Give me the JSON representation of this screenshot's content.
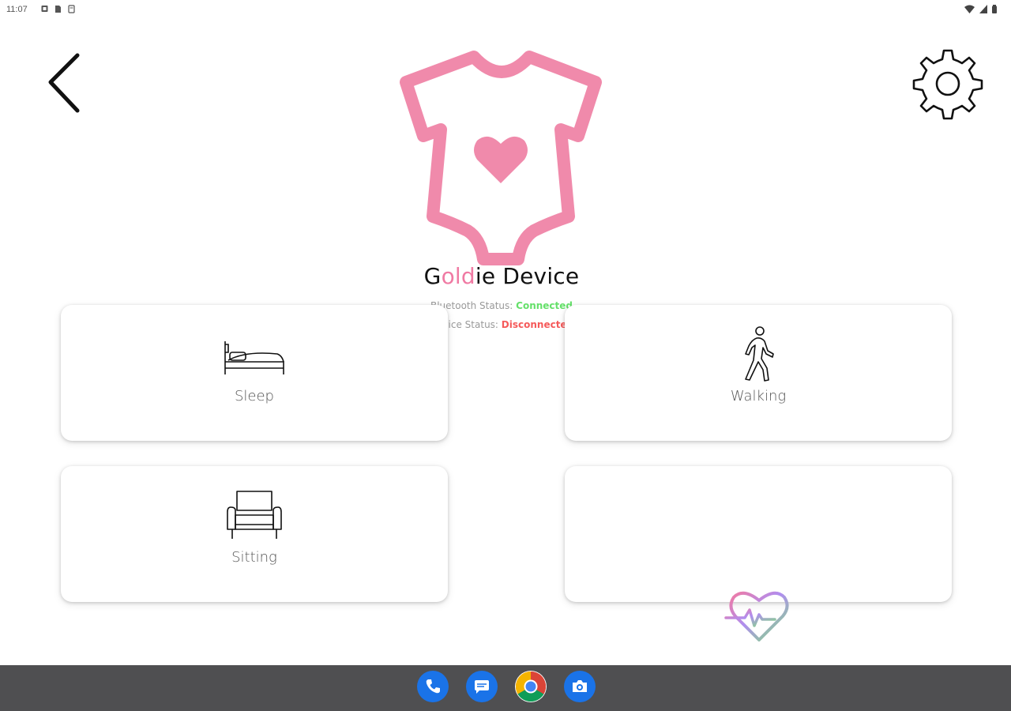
{
  "status_bar": {
    "time": "11:07",
    "left_icons": [
      "notification-icon",
      "sim-card-icon",
      "storage-icon"
    ],
    "right_icons": [
      "wifi-icon",
      "signal-icon",
      "battery-icon"
    ]
  },
  "header": {
    "back_icon": "chevron-left-icon",
    "settings_icon": "gear-icon"
  },
  "device": {
    "title_parts": [
      "G",
      "old",
      "ie",
      " Device"
    ],
    "bluetooth_label": "Bluetooth Status: ",
    "bluetooth_value": "Connected",
    "device_label": "Device Status: ",
    "device_value": "Disconnected"
  },
  "cards": {
    "sleep": {
      "label": "Sleep",
      "icon": "bed-icon"
    },
    "walking": {
      "label": "Walking",
      "icon": "walking-person-icon"
    },
    "sitting": {
      "label": "Sitting",
      "icon": "armchair-icon"
    },
    "heart": {
      "label": "",
      "icon": "heart-rate-icon"
    }
  },
  "dock": [
    {
      "name": "phone",
      "icon": "phone-icon",
      "color": "#1a73e8"
    },
    {
      "name": "messages",
      "icon": "messages-icon",
      "color": "#1a73e8"
    },
    {
      "name": "chrome",
      "icon": "chrome-icon",
      "color": "#ffffff"
    },
    {
      "name": "camera",
      "icon": "camera-icon",
      "color": "#1a73e8"
    }
  ],
  "colors": {
    "brand_pink": "#f07aa3",
    "connected": "#65e06a",
    "disconnected": "#f55a5a",
    "navbar": "#4f4f51"
  }
}
